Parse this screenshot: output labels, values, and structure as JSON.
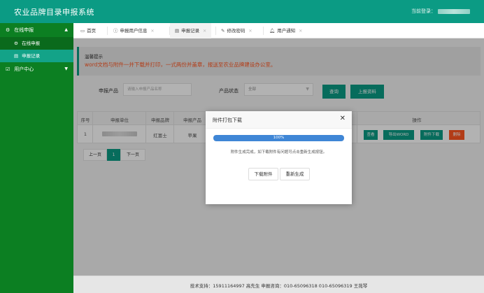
{
  "header": {
    "title": "农业品牌目录申报系统",
    "user_label": "当前登录："
  },
  "sidebar": {
    "groups": [
      {
        "label": "在线申报",
        "icon": "gear-icon",
        "expanded": true,
        "items": [
          {
            "label": "在线申报",
            "icon": "gear-icon"
          },
          {
            "label": "申报记录",
            "icon": "list-icon",
            "active": true
          }
        ]
      },
      {
        "label": "用户中心",
        "icon": "user-icon",
        "expanded": false
      }
    ]
  },
  "tabs": [
    {
      "label": "首页",
      "icon": "monitor-icon",
      "closable": false
    },
    {
      "label": "申报用户信息",
      "icon": "info-icon",
      "closable": true
    },
    {
      "label": "申报记录",
      "icon": "list-icon",
      "closable": true,
      "active": true
    },
    {
      "label": "修改密码",
      "icon": "edit-icon",
      "closable": true
    },
    {
      "label": "用户通知",
      "icon": "bell-icon",
      "closable": true
    }
  ],
  "notice": {
    "heading": "温馨提示",
    "text": "word文档与附件一并下载并打印，一式两份并盖章，报送至农业品牌建设办公室。"
  },
  "filter": {
    "product_label": "申报产品",
    "product_placeholder": "请输入申报产品名称",
    "status_label": "产品状态",
    "status_value": "全部",
    "search_button": "查询",
    "upload_button": "上报资料"
  },
  "table": {
    "headers": [
      "序号",
      "申报单位",
      "申报品牌",
      "申报产品",
      "操作"
    ],
    "rows": [
      {
        "index": "1",
        "unit": "",
        "brand": "红富士",
        "product": "苹果"
      }
    ],
    "actions": [
      "查看",
      "导出WORD",
      "附件下载",
      "删除"
    ]
  },
  "pager": {
    "prev": "上一页",
    "current": "1",
    "next": "下一页"
  },
  "modal": {
    "title": "附件打包下载",
    "progress": 1.0,
    "progress_text": "100%",
    "message": "附件生成完成，如下载附件有问题可点击重新生成按钮。",
    "download_button": "下载附件",
    "regenerate_button": "重新生成"
  },
  "footer": {
    "text": "技术支持：15911164997   高先生   申报咨询：010-65096318   010-65096319   王苑琴"
  },
  "colors": {
    "header_bg": "#0b9b84",
    "sidebar_bg": "#0c7f22",
    "accent": "#0b9b84",
    "danger": "#ff5722",
    "progress": "#3f86d6"
  }
}
